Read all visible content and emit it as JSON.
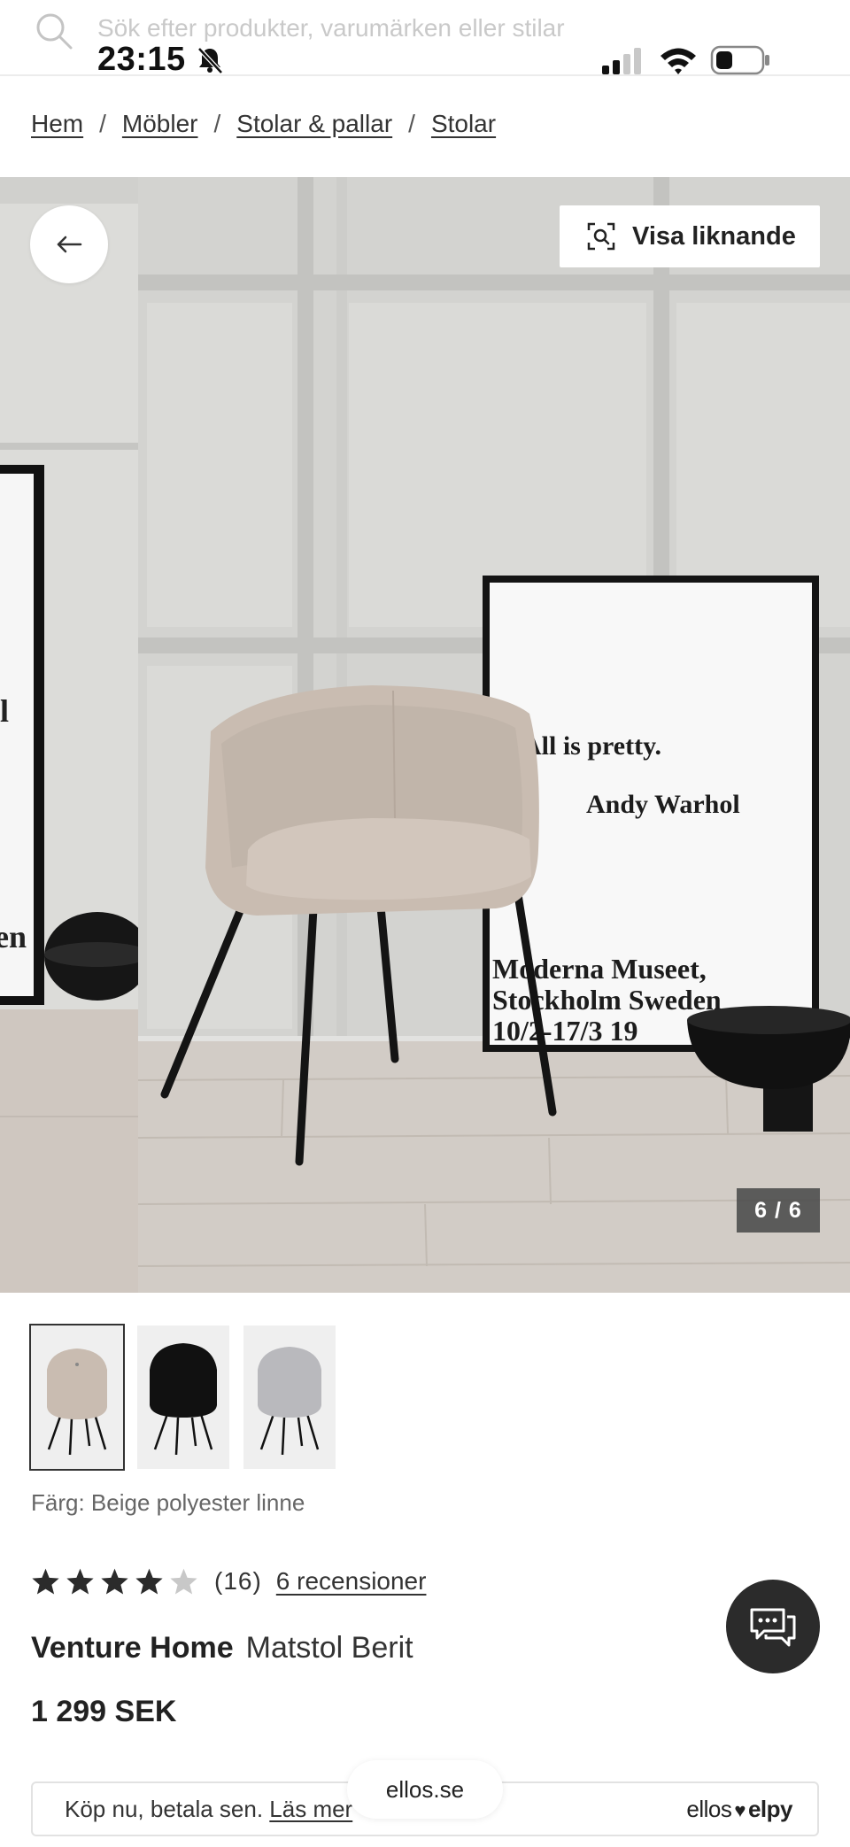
{
  "search": {
    "placeholder": "Sök efter produkter, varumärken eller stilar"
  },
  "status": {
    "time": "23:15"
  },
  "breadcrumb": [
    {
      "label": "Hem"
    },
    {
      "label": "Möbler"
    },
    {
      "label": "Stolar & pallar"
    },
    {
      "label": "Stolar"
    }
  ],
  "gallery": {
    "similar_label": "Visa liknande",
    "counter": "6 / 6",
    "poster_lines": [
      "All is pretty.",
      "Andy Warhol",
      "Moderna Museet,",
      "Stockholm Sweden",
      "10/2-17/3 19"
    ],
    "left_poster_fragments": [
      "l",
      "en"
    ]
  },
  "product": {
    "color_label": "Färg: Beige polyester linne",
    "rating_value": 4,
    "rating_max": 5,
    "rating_count": "(16)",
    "reviews_link": "6 recensioner",
    "brand": "Venture Home",
    "name": "Matstol Berit",
    "price": "1 299 SEK",
    "thumbnails": [
      {
        "color": "#c9bcb1",
        "active": true
      },
      {
        "color": "#111111",
        "active": false
      },
      {
        "color": "#b9b9bd",
        "active": false
      }
    ]
  },
  "payment": {
    "text": "Köp nu, betala sen.",
    "link": "Läs mer",
    "logo_left": "ellos",
    "logo_heart": "♥",
    "logo_right": "elpy"
  },
  "site": {
    "domain": "ellos.se"
  },
  "colors": {
    "accent_dark": "#2b2b2b",
    "chair": "#c9bcb1"
  }
}
